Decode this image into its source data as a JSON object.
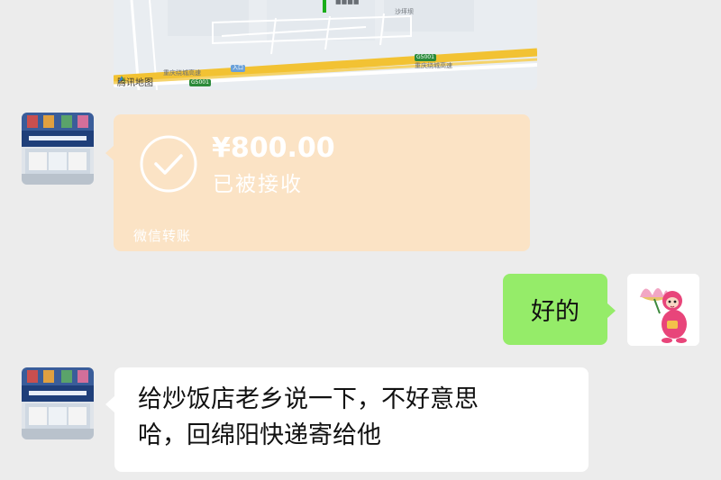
{
  "map": {
    "attribution": "腾讯地图",
    "highway_labels": [
      "重庆绕城高速",
      "重庆绕城高速"
    ],
    "highway_codes": [
      "G5001",
      "G5001"
    ],
    "place_labels": [
      "沙坪坝",
      "入口"
    ],
    "colors": {
      "highway": "#f2c233",
      "road": "#ffffff",
      "background": "#e9edf1"
    }
  },
  "messages": [
    {
      "sender": "contact",
      "type": "transfer",
      "amount": "¥800.00",
      "status": "已被接收",
      "footer": "微信转账",
      "color": "#fbe3c5"
    },
    {
      "sender": "self",
      "type": "text",
      "text": "好的",
      "color": "#95ec69"
    },
    {
      "sender": "contact",
      "type": "text",
      "lines": [
        "给炒饭店老乡说一下，不好意思",
        "哈，回绵阳快递寄给他"
      ],
      "color": "#ffffff"
    }
  ],
  "icons": {
    "transfer": "check-circle-icon",
    "map_logo": "tencent-map-logo-icon"
  }
}
